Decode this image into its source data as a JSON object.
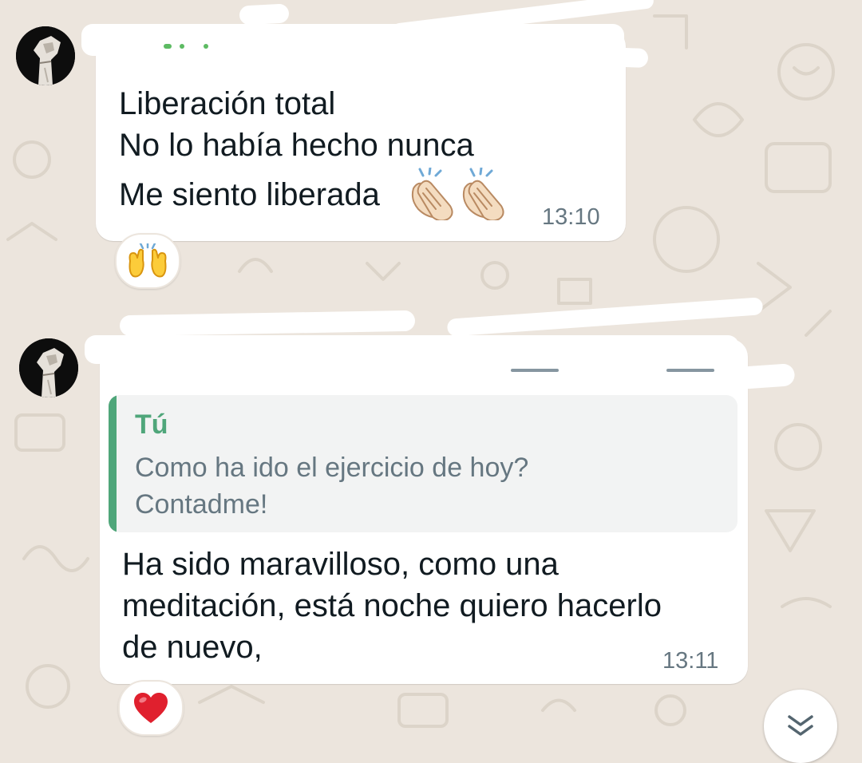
{
  "messages": [
    {
      "lines": [
        "Liberación total",
        "No lo había hecho nunca",
        "Me siento liberada"
      ],
      "emoji": [
        "clapping-hands",
        "clapping-hands"
      ],
      "time": "13:10",
      "reaction": "raising-hands"
    },
    {
      "quote": {
        "author": "Tú",
        "lines": [
          "Como ha ido el ejercicio de hoy?",
          "Contadme!"
        ]
      },
      "lines": [
        "Ha sido maravilloso, como una",
        "meditación, está noche quiero hacerlo",
        "de nuevo,"
      ],
      "time": "13:11",
      "reaction": "red-heart"
    }
  ],
  "colors": {
    "background": "#ece5dd",
    "bubble": "#ffffff",
    "quote_accent": "#4fa67a",
    "text": "#111b21",
    "muted": "#667781",
    "heart": "#e0202e"
  },
  "icons": {
    "scroll_down": "double-chevron-down-icon"
  }
}
